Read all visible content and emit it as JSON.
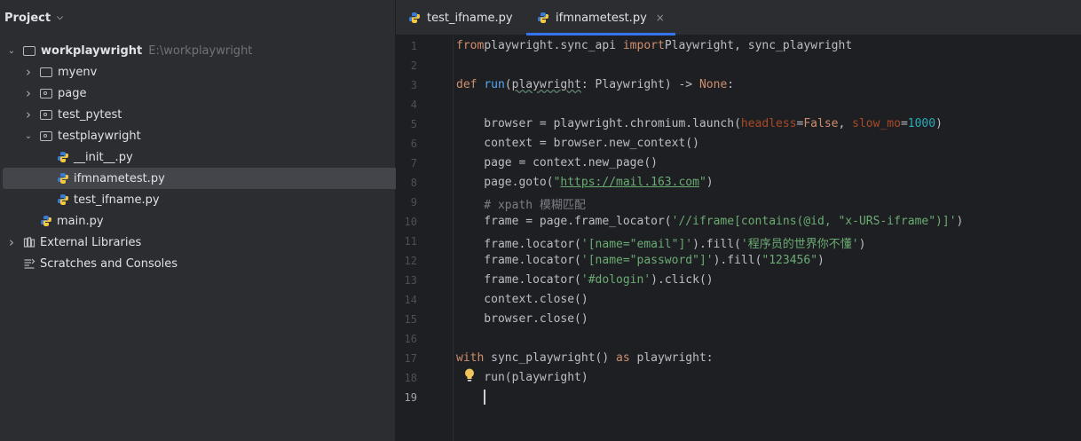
{
  "project_panel": {
    "title": "Project",
    "tree": [
      {
        "label": "workplaywright",
        "path": "E:\\workplaywright",
        "type": "folder",
        "expanded": true,
        "depth": 0
      },
      {
        "label": "myenv",
        "type": "folder",
        "expanded": false,
        "depth": 1
      },
      {
        "label": "page",
        "type": "package",
        "expanded": false,
        "depth": 1
      },
      {
        "label": "test_pytest",
        "type": "package",
        "expanded": false,
        "depth": 1
      },
      {
        "label": "testplaywright",
        "type": "package",
        "expanded": true,
        "depth": 1
      },
      {
        "label": "__init__.py",
        "type": "python",
        "depth": 2
      },
      {
        "label": "ifmnametest.py",
        "type": "python",
        "depth": 2,
        "selected": true
      },
      {
        "label": "test_ifname.py",
        "type": "python",
        "depth": 2
      },
      {
        "label": "main.py",
        "type": "python",
        "depth": 1
      },
      {
        "label": "External Libraries",
        "type": "library",
        "expanded": false,
        "depth": 0
      },
      {
        "label": "Scratches and Consoles",
        "type": "scratches",
        "depth": 0
      }
    ]
  },
  "editor": {
    "tabs": [
      {
        "label": "test_ifname.py",
        "active": false
      },
      {
        "label": "ifmnametest.py",
        "active": true,
        "close": "×"
      }
    ],
    "current_line": 19,
    "lines": [
      [
        [
          "kw",
          "from"
        ],
        [
          "",
          "playwright.sync_api "
        ],
        [
          "kw",
          "import"
        ],
        [
          "",
          "Playwright, sync_playwright"
        ]
      ],
      [],
      [
        [
          "kw",
          "def "
        ],
        [
          "fn",
          "run"
        ],
        [
          "",
          "("
        ],
        [
          "wavy",
          "playwright"
        ],
        [
          "",
          ": Playwright) -> "
        ],
        [
          "kw",
          "None"
        ],
        [
          "",
          ":"
        ]
      ],
      [],
      [
        [
          "",
          "    browser = playwright.chromium.launch("
        ],
        [
          "param",
          "headless"
        ],
        [
          "",
          "="
        ],
        [
          "kw",
          "False"
        ],
        [
          "",
          ", "
        ],
        [
          "param",
          "slow_mo"
        ],
        [
          "",
          "="
        ],
        [
          "num",
          "1000"
        ],
        [
          "",
          ")"
        ]
      ],
      [
        [
          "",
          "    context = browser.new_context()"
        ]
      ],
      [
        [
          "",
          "    page = context.new_page()"
        ]
      ],
      [
        [
          "",
          "    page.goto("
        ],
        [
          "str",
          "\""
        ],
        [
          "link",
          "https://mail.163.com"
        ],
        [
          "str",
          "\""
        ],
        [
          "",
          ")"
        ]
      ],
      [
        [
          "cmt",
          "    # xpath 模糊匹配"
        ]
      ],
      [
        [
          "",
          "    frame = page.frame_locator("
        ],
        [
          "str",
          "'//iframe[contains(@id, \"x-URS-iframe\")]'"
        ],
        [
          "",
          ")"
        ]
      ],
      [
        [
          "",
          "    frame.locator("
        ],
        [
          "str",
          "'[name=\"email\"]'"
        ],
        [
          "",
          ").fill("
        ],
        [
          "str",
          "'程序员的世界你不懂'"
        ],
        [
          "",
          ")"
        ]
      ],
      [
        [
          "",
          "    frame.locator("
        ],
        [
          "str",
          "'[name=\"password\"]'"
        ],
        [
          "",
          ").fill("
        ],
        [
          "str",
          "\"123456\""
        ],
        [
          "",
          ")"
        ]
      ],
      [
        [
          "",
          "    frame.locator("
        ],
        [
          "str",
          "'#dologin'"
        ],
        [
          "",
          ").click()"
        ]
      ],
      [
        [
          "",
          "    context.close()"
        ]
      ],
      [
        [
          "",
          "    browser.close()"
        ]
      ],
      [],
      [
        [
          "kw",
          "with "
        ],
        [
          "",
          "sync_playwright() "
        ],
        [
          "kw",
          "as "
        ],
        [
          "",
          "playwright:"
        ]
      ],
      [
        [
          "",
          "    run(playwright)"
        ]
      ],
      [
        [
          "",
          "    "
        ]
      ]
    ]
  },
  "colors": {
    "accent": "#3574f0",
    "background": "#1e1f22",
    "panel": "#2b2d30",
    "selection": "#43454a"
  },
  "icons": {
    "python": "python-file-icon",
    "folder": "folder-icon",
    "package": "package-folder-icon",
    "library": "library-icon",
    "scratches": "scratches-icon",
    "intention": "lightbulb-icon"
  }
}
